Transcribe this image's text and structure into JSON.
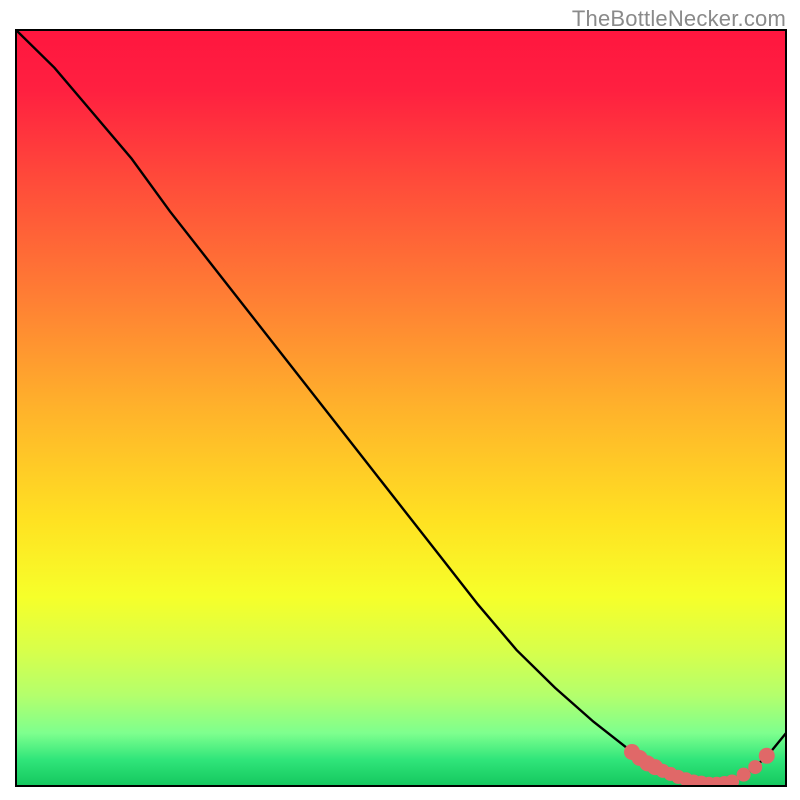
{
  "attribution": "TheBottleNecker.com",
  "chart_data": {
    "type": "line",
    "title": "",
    "xlabel": "",
    "ylabel": "",
    "xlim": [
      0,
      100
    ],
    "ylim": [
      0,
      100
    ],
    "background_gradient": {
      "stops": [
        {
          "offset": 0.0,
          "color": "#ff163f"
        },
        {
          "offset": 0.08,
          "color": "#ff2040"
        },
        {
          "offset": 0.2,
          "color": "#ff4b3a"
        },
        {
          "offset": 0.35,
          "color": "#ff7d34"
        },
        {
          "offset": 0.5,
          "color": "#ffb22b"
        },
        {
          "offset": 0.65,
          "color": "#ffe222"
        },
        {
          "offset": 0.75,
          "color": "#f6ff2a"
        },
        {
          "offset": 0.82,
          "color": "#d8ff4a"
        },
        {
          "offset": 0.88,
          "color": "#b4ff6c"
        },
        {
          "offset": 0.93,
          "color": "#7eff8e"
        },
        {
          "offset": 0.965,
          "color": "#30e57a"
        },
        {
          "offset": 1.0,
          "color": "#14c75e"
        }
      ]
    },
    "series": [
      {
        "name": "bottleneck-curve",
        "color": "#000000",
        "x": [
          0.0,
          5.0,
          10.0,
          15.0,
          20.0,
          25.0,
          30.0,
          35.0,
          40.0,
          45.0,
          50.0,
          55.0,
          60.0,
          65.0,
          70.0,
          75.0,
          80.0,
          82.0,
          84.0,
          86.0,
          88.0,
          90.0,
          92.0,
          94.0,
          96.0,
          98.0,
          100.0
        ],
        "y": [
          100.0,
          95.0,
          89.0,
          83.0,
          76.0,
          69.5,
          63.0,
          56.5,
          50.0,
          43.5,
          37.0,
          30.5,
          24.0,
          18.0,
          13.0,
          8.5,
          4.5,
          3.0,
          2.0,
          1.2,
          0.6,
          0.3,
          0.4,
          1.0,
          2.5,
          4.5,
          7.0
        ]
      }
    ],
    "markers": {
      "name": "highlight-dots",
      "color": "#e06868",
      "x": [
        80.0,
        81.0,
        82.0,
        83.0,
        84.0,
        85.0,
        86.0,
        87.0,
        88.0,
        89.0,
        90.0,
        91.0,
        92.0,
        93.0,
        94.5,
        96.0,
        97.5
      ],
      "y": [
        4.5,
        3.7,
        3.0,
        2.5,
        2.0,
        1.6,
        1.2,
        0.9,
        0.6,
        0.45,
        0.3,
        0.3,
        0.4,
        0.6,
        1.5,
        2.5,
        4.0
      ],
      "r": [
        8,
        8,
        8,
        8,
        7,
        7,
        7,
        7,
        7,
        7,
        7,
        7,
        7,
        7,
        7,
        7,
        8
      ]
    }
  }
}
